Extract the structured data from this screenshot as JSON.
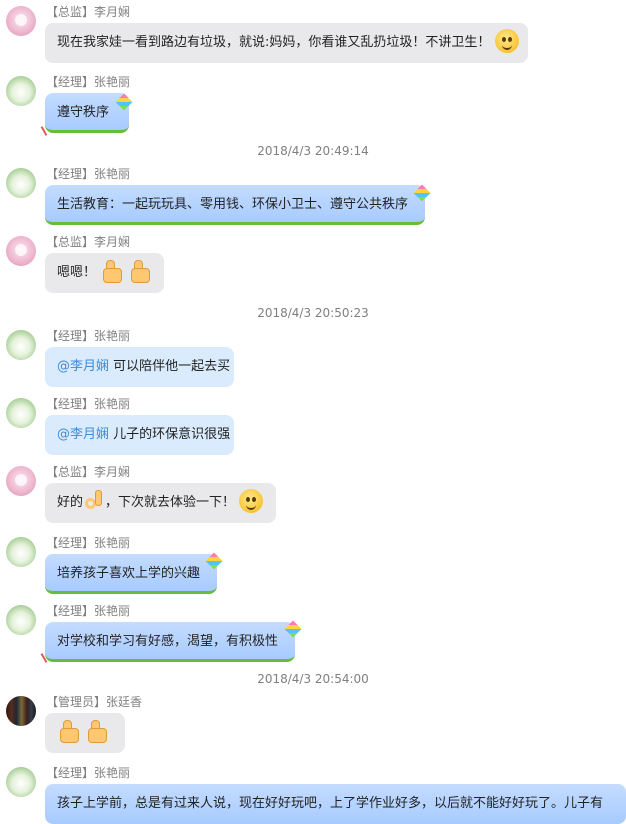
{
  "chat": {
    "messages": [
      {
        "role": "【总监】",
        "name": "李月娴",
        "avatar": "pink",
        "style": "gray",
        "text": "现在我家娃一看到路边有垃圾，就说:妈妈，你看谁又乱扔垃圾！不讲卫生！",
        "emoji": [
          "grin-face"
        ]
      },
      {
        "role": "【经理】",
        "name": "张艳丽",
        "avatar": "green",
        "style": "blue",
        "text": "遵守秩序"
      },
      {
        "timestamp": "2018/4/3 20:49:14"
      },
      {
        "role": "【经理】",
        "name": "张艳丽",
        "avatar": "green",
        "style": "blue",
        "text": "生活教育：一起玩玩具、零用钱、环保小卫士、遵守公共秩序"
      },
      {
        "role": "【总监】",
        "name": "李月娴",
        "avatar": "pink",
        "style": "gray",
        "text": "嗯嗯！",
        "emoji": [
          "thumbs-up",
          "thumbs-up"
        ]
      },
      {
        "timestamp": "2018/4/3 20:50:23"
      },
      {
        "role": "【经理】",
        "name": "张艳丽",
        "avatar": "green",
        "style": "lightblue",
        "mention": "@李月娴",
        "text": " 可以陪伴他一起去买"
      },
      {
        "role": "【经理】",
        "name": "张艳丽",
        "avatar": "green",
        "style": "lightblue",
        "mention": "@李月娴",
        "text": " 儿子的环保意识很强"
      },
      {
        "role": "【总监】",
        "name": "李月娴",
        "avatar": "pink",
        "style": "gray",
        "text_before": "好的",
        "emoji_mid": "ok-hand",
        "text": "，下次就去体验一下！",
        "emoji": [
          "smile-face"
        ]
      },
      {
        "role": "【经理】",
        "name": "张艳丽",
        "avatar": "green",
        "style": "blue",
        "text": "培养孩子喜欢上学的兴趣"
      },
      {
        "role": "【经理】",
        "name": "张艳丽",
        "avatar": "green",
        "style": "blue",
        "text": "对学校和学习有好感，渴望，有积极性"
      },
      {
        "timestamp": "2018/4/3 20:54:00"
      },
      {
        "role": "【管理员】",
        "name": "张廷香",
        "avatar": "books",
        "style": "gray",
        "text": "",
        "emoji": [
          "thumbs-up",
          "thumbs-up"
        ]
      },
      {
        "role": "【经理】",
        "name": "张艳丽",
        "avatar": "green",
        "style": "blue",
        "text": "孩子上学前，总是有过来人说，现在好好玩吧，上了学作业好多，以后就不能好好玩了。儿子有"
      }
    ]
  },
  "colors": {
    "gray_bubble": "#e9e9eb",
    "blue_bubble": "#a7cbff",
    "mention": "#3d8bd8",
    "timestamp": "#7f7f7f"
  }
}
